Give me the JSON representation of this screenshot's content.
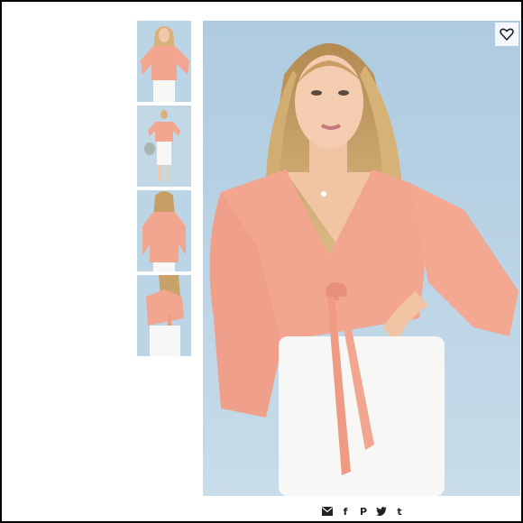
{
  "gallery": {
    "thumbnails": [
      {
        "icon": "model-front-view",
        "selected": false
      },
      {
        "icon": "model-full-length-view",
        "selected": false
      },
      {
        "icon": "model-back-view",
        "selected": false
      },
      {
        "icon": "model-side-tie-view",
        "selected": false
      }
    ],
    "main_image": {
      "icon": "model-wearing-peach-tie-front-top"
    },
    "like_icon": "heart-icon"
  },
  "share": {
    "icons": [
      "email-icon",
      "facebook-icon",
      "pinterest-icon",
      "twitter-icon",
      "tumblr-icon"
    ],
    "glyphs": {
      "facebook": "f",
      "pinterest": "P",
      "tumblr": "t"
    }
  },
  "colors": {
    "background": "#ffffff",
    "frame": "#000000",
    "photo_backdrop": "#bcd5e6",
    "top_color": "#f2a68f",
    "skirt_color": "#f7f7f5",
    "icon_color": "#222222"
  }
}
